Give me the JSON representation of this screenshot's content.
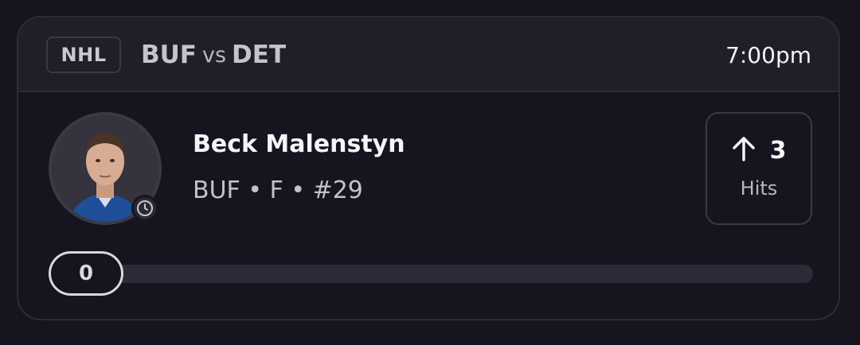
{
  "header": {
    "league": "NHL",
    "home_team": "BUF",
    "vs_label": "vs",
    "away_team": "DET",
    "time": "7:00pm"
  },
  "player": {
    "name": "Beck Malenstyn",
    "meta": "BUF • F • #29",
    "avatar_icon": "player-headshot",
    "status_icon": "clock-icon"
  },
  "stat": {
    "direction_icon": "arrow-up-icon",
    "value": "3",
    "label": "Hits"
  },
  "progress": {
    "current_label": "0",
    "current": 0,
    "target": 3
  },
  "colors": {
    "background": "#15141f",
    "header": "#1f1e29",
    "border": "#2c2b37",
    "text": "#f2f2f5"
  }
}
